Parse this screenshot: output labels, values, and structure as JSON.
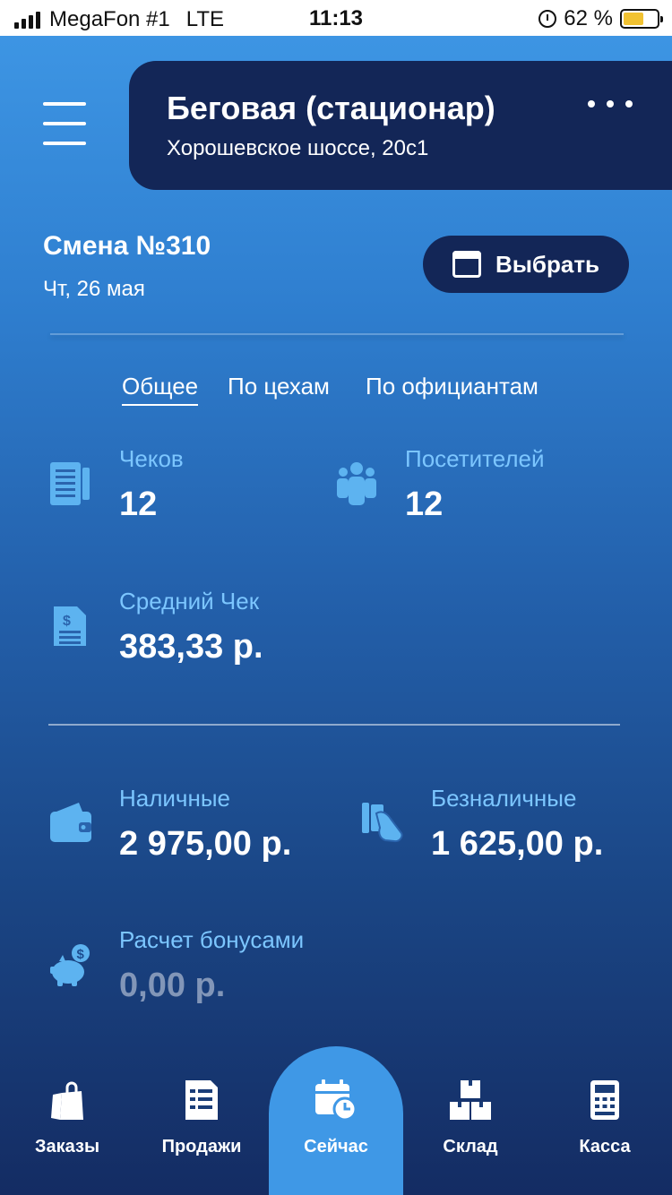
{
  "status_bar": {
    "carrier": "MegaFon #1",
    "network": "LTE",
    "time": "11:13",
    "battery_percent": "62 %",
    "battery_level": 0.62
  },
  "header": {
    "venue_title": "Беговая (стационар)",
    "venue_address": "Хорошевское шоссе, 20с1"
  },
  "shift": {
    "title": "Смена №310",
    "date": "Чт, 26 мая",
    "choose_label": "Выбрать"
  },
  "tabs": [
    {
      "label": "Общее",
      "active": true
    },
    {
      "label": "По цехам",
      "active": false
    },
    {
      "label": "По официантам",
      "active": false
    }
  ],
  "stats": {
    "checks": {
      "label": "Чеков",
      "value": "12"
    },
    "visitors": {
      "label": "Посетителей",
      "value": "12"
    },
    "average_check": {
      "label": "Средний Чек",
      "value": "383,33 р."
    },
    "cash": {
      "label": "Наличные",
      "value": "2 975,00 р."
    },
    "cashless": {
      "label": "Безналичные",
      "value": "1 625,00 р."
    },
    "bonus": {
      "label": "Расчет бонусами",
      "value": "0,00 р."
    }
  },
  "nav": [
    {
      "label": "Заказы",
      "icon": "shopping-bag-icon"
    },
    {
      "label": "Продажи",
      "icon": "receipt-icon"
    },
    {
      "label": "Сейчас",
      "icon": "calendar-clock-icon",
      "active": true
    },
    {
      "label": "Склад",
      "icon": "boxes-icon"
    },
    {
      "label": "Касса",
      "icon": "cash-register-icon"
    }
  ],
  "colors": {
    "accent_label": "#7cc6ff",
    "card_dark": "#132657",
    "active_tab_bg": "#3f98e6",
    "icon_blue": "#5db3f0"
  }
}
